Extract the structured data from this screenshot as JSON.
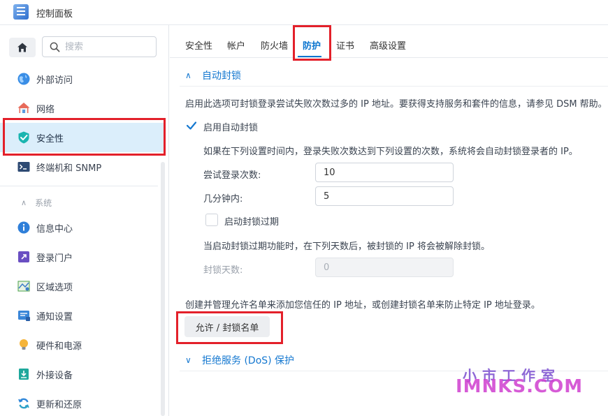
{
  "window": {
    "title": "控制面板"
  },
  "sidebar": {
    "search_placeholder": "搜索",
    "items": [
      {
        "label": "外部访问",
        "icon": "globe-icon"
      },
      {
        "label": "网络",
        "icon": "network-house-icon"
      },
      {
        "label": "安全性",
        "icon": "shield-icon",
        "active": true
      },
      {
        "label": "终端机和 SNMP",
        "icon": "terminal-icon"
      }
    ],
    "section_label": "系统",
    "system_items": [
      {
        "label": "信息中心",
        "icon": "info-icon"
      },
      {
        "label": "登录门户",
        "icon": "login-portal-icon"
      },
      {
        "label": "区域选项",
        "icon": "region-map-icon"
      },
      {
        "label": "通知设置",
        "icon": "notification-icon"
      },
      {
        "label": "硬件和电源",
        "icon": "lightbulb-icon"
      },
      {
        "label": "外接设备",
        "icon": "external-device-icon"
      },
      {
        "label": "更新和还原",
        "icon": "update-icon"
      }
    ]
  },
  "tabs": [
    {
      "label": "安全性"
    },
    {
      "label": "帐户"
    },
    {
      "label": "防火墙"
    },
    {
      "label": "防护",
      "active": true
    },
    {
      "label": "证书"
    },
    {
      "label": "高级设置"
    }
  ],
  "auto_block": {
    "title": "自动封锁",
    "description": "启用此选项可封锁登录尝试失败次数过多的 IP 地址。要获得支持服务和套件的信息，请参见 DSM 帮助。",
    "enable_label": "启用自动封锁",
    "enabled": true,
    "rule_text": "如果在下列设置时间内，登录失败次数达到下列设置的次数，系统将会自动封锁登录者的 IP。",
    "attempts_label": "尝试登录次数:",
    "attempts_value": "10",
    "minutes_label": "几分钟内:",
    "minutes_value": "5",
    "expire_label": "启动封锁过期",
    "expire_enabled": false,
    "expire_text": "当启动封锁过期功能时，在下列天数后，被封锁的 IP 将会被解除封锁。",
    "days_label": "封锁天数:",
    "days_value": "0"
  },
  "allow_block": {
    "text": "创建并管理允许名单来添加您信任的 IP 地址，或创建封锁名单来防止特定 IP 地址登录。",
    "button_label": "允许 / 封锁名单"
  },
  "dos": {
    "title": "拒绝服务 (DoS) 保护"
  },
  "watermark": {
    "top": "小市工作室",
    "bottom": "IMNKS.COM"
  },
  "colors": {
    "accent": "#0a74cf",
    "highlight_box": "#e3202a",
    "active_bg": "#dbeefb"
  }
}
